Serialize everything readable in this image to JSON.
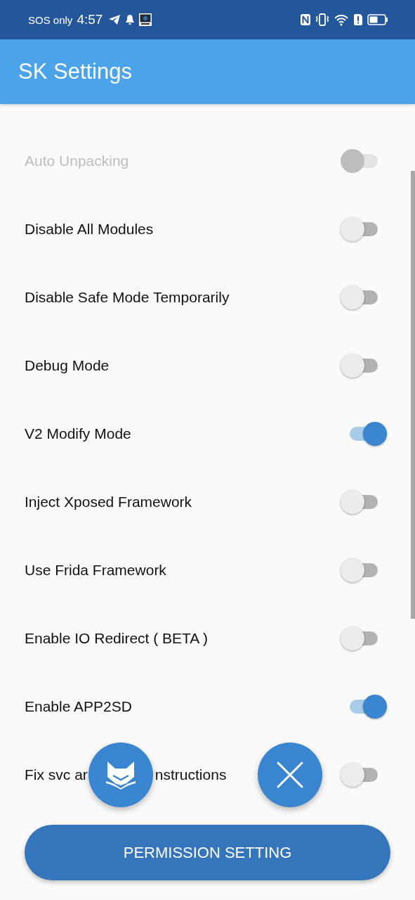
{
  "status_bar": {
    "carrier": "SOS only",
    "time": "4:57"
  },
  "app_bar": {
    "title": "SK Settings"
  },
  "rows": [
    {
      "label": "Auto Unpacking",
      "on": false,
      "disabled": true
    },
    {
      "label": "Disable All Modules",
      "on": false,
      "disabled": false
    },
    {
      "label": "Disable Safe Mode Temporarily",
      "on": false,
      "disabled": false
    },
    {
      "label": "Debug Mode",
      "on": false,
      "disabled": false
    },
    {
      "label": "V2 Modify Mode",
      "on": true,
      "disabled": false
    },
    {
      "label": "Inject Xposed Framework",
      "on": false,
      "disabled": false
    },
    {
      "label": "Use Frida Framework",
      "on": false,
      "disabled": false
    },
    {
      "label": "Enable IO Redirect ( BETA )",
      "on": false,
      "disabled": false
    },
    {
      "label": "Enable APP2SD",
      "on": true,
      "disabled": false
    },
    {
      "label_parts": [
        "Fix svc ar",
        "nstructions"
      ],
      "on": false,
      "disabled": false
    }
  ],
  "bottom_button": {
    "label": "PERMISSION SETTING"
  }
}
